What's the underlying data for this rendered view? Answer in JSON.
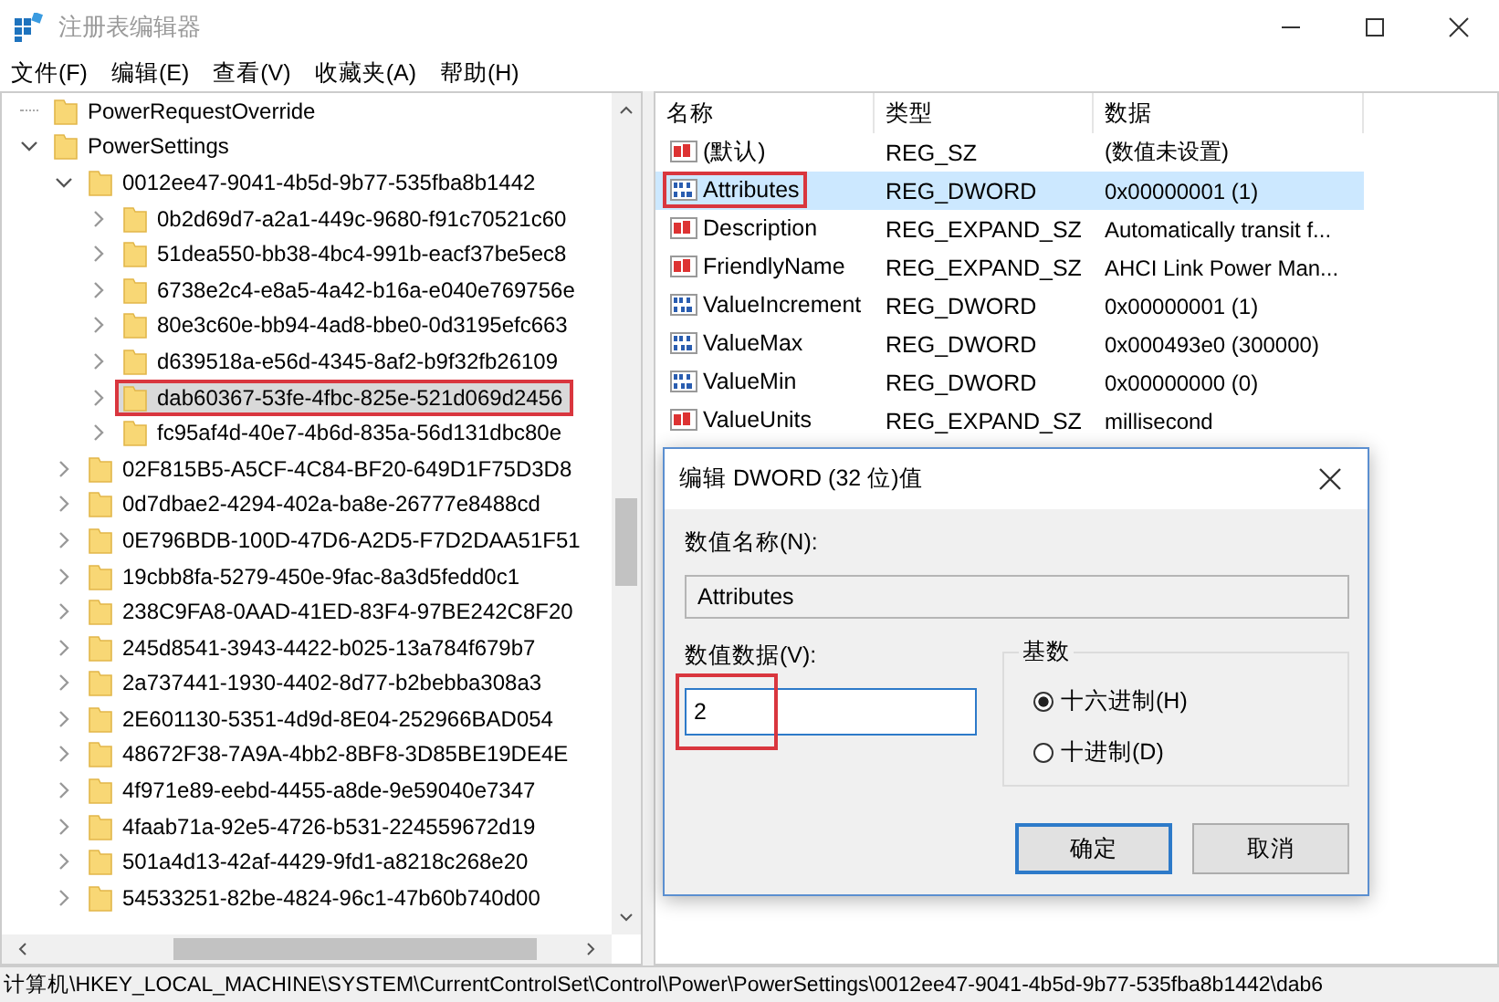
{
  "window": {
    "title": "注册表编辑器"
  },
  "menu": [
    "文件(F)",
    "编辑(E)",
    "查看(V)",
    "收藏夹(A)",
    "帮助(H)"
  ],
  "tree": [
    {
      "label": "PowerRequestOverride",
      "has_children": false,
      "selected": false,
      "annotated": false
    },
    {
      "label": "PowerSettings",
      "has_children": true,
      "expanded": true,
      "selected": false,
      "annotated": false,
      "children": [
        {
          "label": "0012ee47-9041-4b5d-9b77-535fba8b1442",
          "has_children": true,
          "expanded": true,
          "selected": false,
          "annotated": false,
          "children": [
            {
              "label": "0b2d69d7-a2a1-449c-9680-f91c70521c60",
              "has_children": true,
              "expanded": false,
              "selected": false,
              "annotated": false
            },
            {
              "label": "51dea550-bb38-4bc4-991b-eacf37be5ec8",
              "has_children": true,
              "expanded": false,
              "selected": false,
              "annotated": false
            },
            {
              "label": "6738e2c4-e8a5-4a42-b16a-e040e769756e",
              "has_children": true,
              "expanded": false,
              "selected": false,
              "annotated": false
            },
            {
              "label": "80e3c60e-bb94-4ad8-bbe0-0d3195efc663",
              "has_children": true,
              "expanded": false,
              "selected": false,
              "annotated": false
            },
            {
              "label": "d639518a-e56d-4345-8af2-b9f32fb26109",
              "has_children": true,
              "expanded": false,
              "selected": false,
              "annotated": false
            },
            {
              "label": "dab60367-53fe-4fbc-825e-521d069d2456",
              "has_children": true,
              "expanded": false,
              "selected": true,
              "annotated": true
            },
            {
              "label": "fc95af4d-40e7-4b6d-835a-56d131dbc80e",
              "has_children": true,
              "expanded": false,
              "selected": false,
              "annotated": false
            }
          ]
        },
        {
          "label": "02F815B5-A5CF-4C84-BF20-649D1F75D3D8",
          "has_children": true,
          "expanded": false,
          "selected": false,
          "annotated": false
        },
        {
          "label": "0d7dbae2-4294-402a-ba8e-26777e8488cd",
          "has_children": true,
          "expanded": false,
          "selected": false,
          "annotated": false
        },
        {
          "label": "0E796BDB-100D-47D6-A2D5-F7D2DAA51F51",
          "has_children": true,
          "expanded": false,
          "selected": false,
          "annotated": false
        },
        {
          "label": "19cbb8fa-5279-450e-9fac-8a3d5fedd0c1",
          "has_children": true,
          "expanded": false,
          "selected": false,
          "annotated": false
        },
        {
          "label": "238C9FA8-0AAD-41ED-83F4-97BE242C8F20",
          "has_children": true,
          "expanded": false,
          "selected": false,
          "annotated": false
        },
        {
          "label": "245d8541-3943-4422-b025-13a784f679b7",
          "has_children": true,
          "expanded": false,
          "selected": false,
          "annotated": false
        },
        {
          "label": "2a737441-1930-4402-8d77-b2bebba308a3",
          "has_children": true,
          "expanded": false,
          "selected": false,
          "annotated": false
        },
        {
          "label": "2E601130-5351-4d9d-8E04-252966BAD054",
          "has_children": true,
          "expanded": false,
          "selected": false,
          "annotated": false
        },
        {
          "label": "48672F38-7A9A-4bb2-8BF8-3D85BE19DE4E",
          "has_children": true,
          "expanded": false,
          "selected": false,
          "annotated": false
        },
        {
          "label": "4f971e89-eebd-4455-a8de-9e59040e7347",
          "has_children": true,
          "expanded": false,
          "selected": false,
          "annotated": false
        },
        {
          "label": "4faab71a-92e5-4726-b531-224559672d19",
          "has_children": true,
          "expanded": false,
          "selected": false,
          "annotated": false
        },
        {
          "label": "501a4d13-42af-4429-9fd1-a8218c268e20",
          "has_children": true,
          "expanded": false,
          "selected": false,
          "annotated": false
        },
        {
          "label": "54533251-82be-4824-96c1-47b60b740d00",
          "has_children": true,
          "expanded": false,
          "selected": false,
          "annotated": false
        }
      ]
    }
  ],
  "table": {
    "columns": [
      "名称",
      "类型",
      "数据"
    ],
    "rows": [
      {
        "kind": "string",
        "name": "(默认)",
        "type": "REG_SZ",
        "data": "(数值未设置)",
        "selected": false,
        "annotated": false
      },
      {
        "kind": "binary",
        "name": "Attributes",
        "type": "REG_DWORD",
        "data": "0x00000001 (1)",
        "selected": true,
        "annotated": true
      },
      {
        "kind": "string",
        "name": "Description",
        "type": "REG_EXPAND_SZ",
        "data": "Automatically transit f...",
        "selected": false,
        "annotated": false
      },
      {
        "kind": "string",
        "name": "FriendlyName",
        "type": "REG_EXPAND_SZ",
        "data": "AHCI Link Power Man...",
        "selected": false,
        "annotated": false
      },
      {
        "kind": "binary",
        "name": "ValueIncrement",
        "type": "REG_DWORD",
        "data": "0x00000001 (1)",
        "selected": false,
        "annotated": false
      },
      {
        "kind": "binary",
        "name": "ValueMax",
        "type": "REG_DWORD",
        "data": "0x000493e0 (300000)",
        "selected": false,
        "annotated": false
      },
      {
        "kind": "binary",
        "name": "ValueMin",
        "type": "REG_DWORD",
        "data": "0x00000000 (0)",
        "selected": false,
        "annotated": false
      },
      {
        "kind": "string",
        "name": "ValueUnits",
        "type": "REG_EXPAND_SZ",
        "data": "millisecond",
        "selected": false,
        "annotated": false
      }
    ]
  },
  "dialog": {
    "title": "编辑 DWORD (32 位)值",
    "name_label": "数值名称(N):",
    "name_value": "Attributes",
    "data_label": "数值数据(V):",
    "data_value": "2",
    "data_annotated": true,
    "base_label": "基数",
    "base_options": [
      {
        "label": "十六进制(H)",
        "selected": true
      },
      {
        "label": "十进制(D)",
        "selected": false
      }
    ],
    "buttons": [
      {
        "label": "确定",
        "default": true
      },
      {
        "label": "取消",
        "default": false
      }
    ]
  },
  "status_bar": "计算机\\HKEY_LOCAL_MACHINE\\SYSTEM\\CurrentControlSet\\Control\\Power\\PowerSettings\\0012ee47-9041-4b5d-9b77-535fba8b1442\\dab6"
}
